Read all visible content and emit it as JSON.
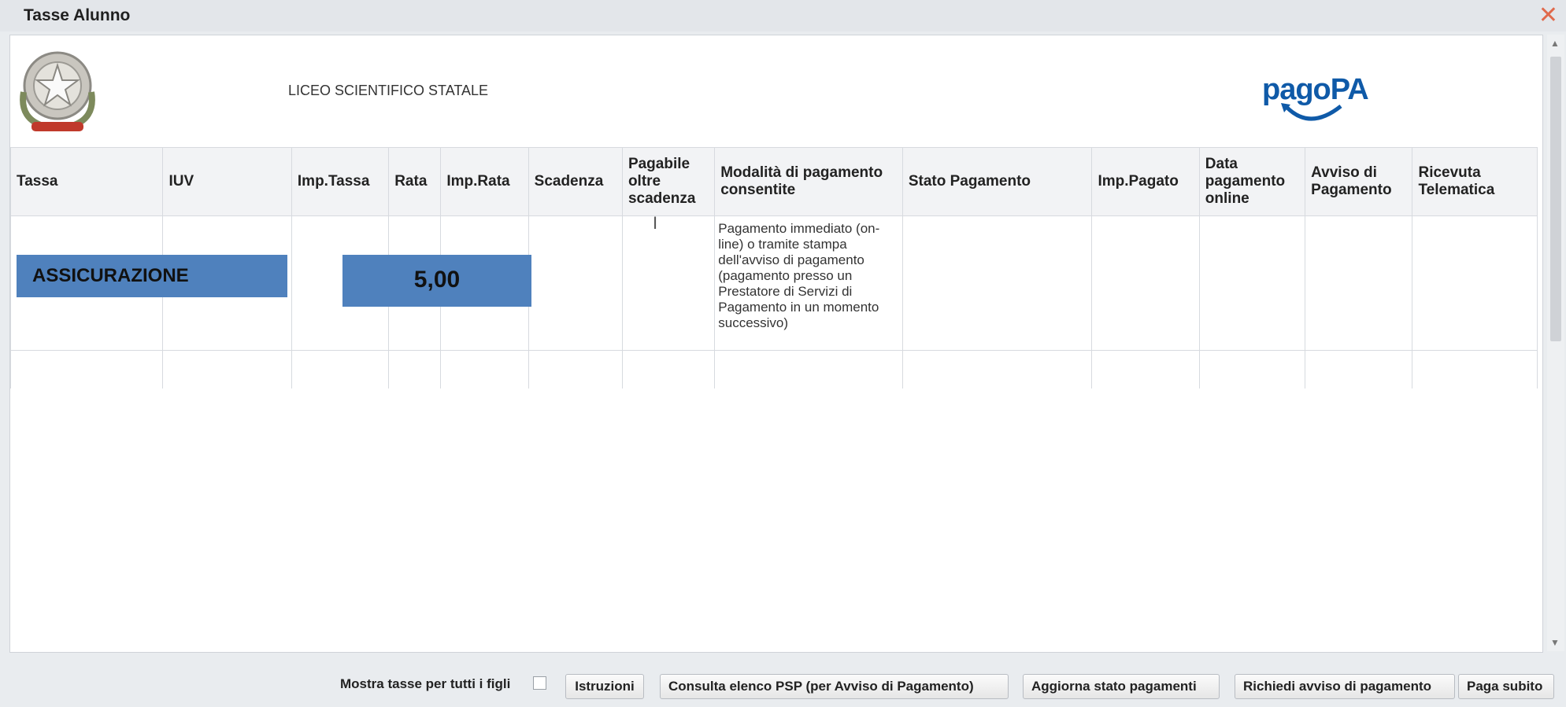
{
  "window": {
    "title": "Tasse Alunno",
    "close_glyph": "✕"
  },
  "header": {
    "school_name": "LICEO SCIENTIFICO STATALE",
    "pagopa_logo_text": "pagoPA"
  },
  "table": {
    "columns": [
      "Tassa",
      "IUV",
      "Imp.Tassa",
      "Rata",
      "Imp.Rata",
      "Scadenza",
      "Pagabile oltre scadenza",
      "Modalità di pagamento consentite",
      "Stato Pagamento",
      "Imp.Pagato",
      "Data pagamento online",
      "Avviso di Pagamento",
      "Ricevuta Telematica"
    ],
    "rows": [
      {
        "tassa": "ASSICURAZIONE",
        "imp_tassa": "5,00",
        "modalita": "Pagamento immediato (on-line) o tramite stampa dell'avviso di pagamento (pagamento presso un Prestatore di Servizi di Pagamento in un momento successivo)"
      }
    ]
  },
  "footer": {
    "show_all_children_label": "Mostra tasse per tutti i figli",
    "buttons": {
      "istruzioni": "Istruzioni",
      "consulta_psp": "Consulta elenco PSP (per Avviso di Pagamento)",
      "aggiorna": "Aggiorna stato pagamenti",
      "richiedi_avviso": "Richiedi avviso di pagamento",
      "paga_subito": "Paga subito"
    }
  },
  "icons": {
    "emblem": "italian-republic-emblem-icon",
    "pagopa": "pagopa-logo-icon",
    "close": "close-icon",
    "cursor": "text-cursor-icon"
  },
  "colors": {
    "highlight": "#4f81bd",
    "pagopa_blue": "#0f5aa8",
    "close": "#e06a4c"
  }
}
